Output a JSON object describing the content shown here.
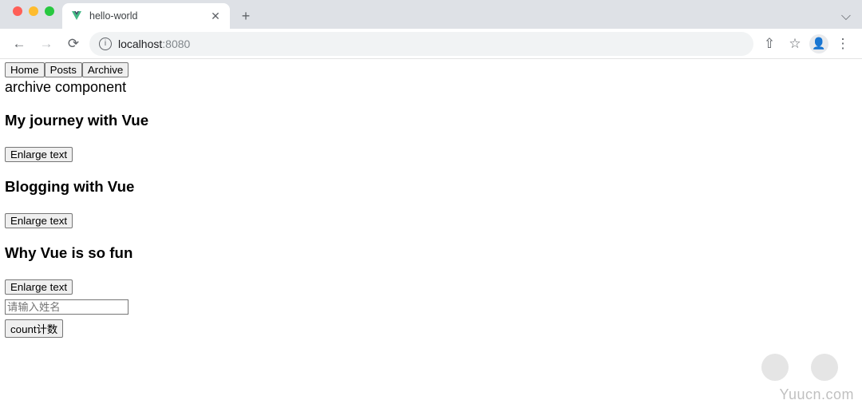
{
  "browser": {
    "tab_title": "hello-world",
    "url_host": "localhost",
    "url_port": ":8080",
    "close_glyph": "✕",
    "new_tab_glyph": "+",
    "expand_glyph": "⌵",
    "back_glyph": "←",
    "forward_glyph": "→",
    "reload_glyph": "⟳",
    "info_glyph": "i",
    "share_glyph": "⇧",
    "star_glyph": "☆",
    "avatar_glyph": "👤",
    "menu_glyph": "⋮"
  },
  "nav": {
    "buttons": [
      "Home",
      "Posts",
      "Archive"
    ]
  },
  "archive_text": "archive component",
  "posts": [
    {
      "title": "My journey with Vue",
      "enlarge_label": "Enlarge text"
    },
    {
      "title": "Blogging with Vue",
      "enlarge_label": "Enlarge text"
    },
    {
      "title": "Why Vue is so fun",
      "enlarge_label": "Enlarge text"
    }
  ],
  "name_input": {
    "value": "",
    "placeholder": "请输入姓名"
  },
  "count_button_label": "count计数",
  "watermark": "Yuucn.com"
}
